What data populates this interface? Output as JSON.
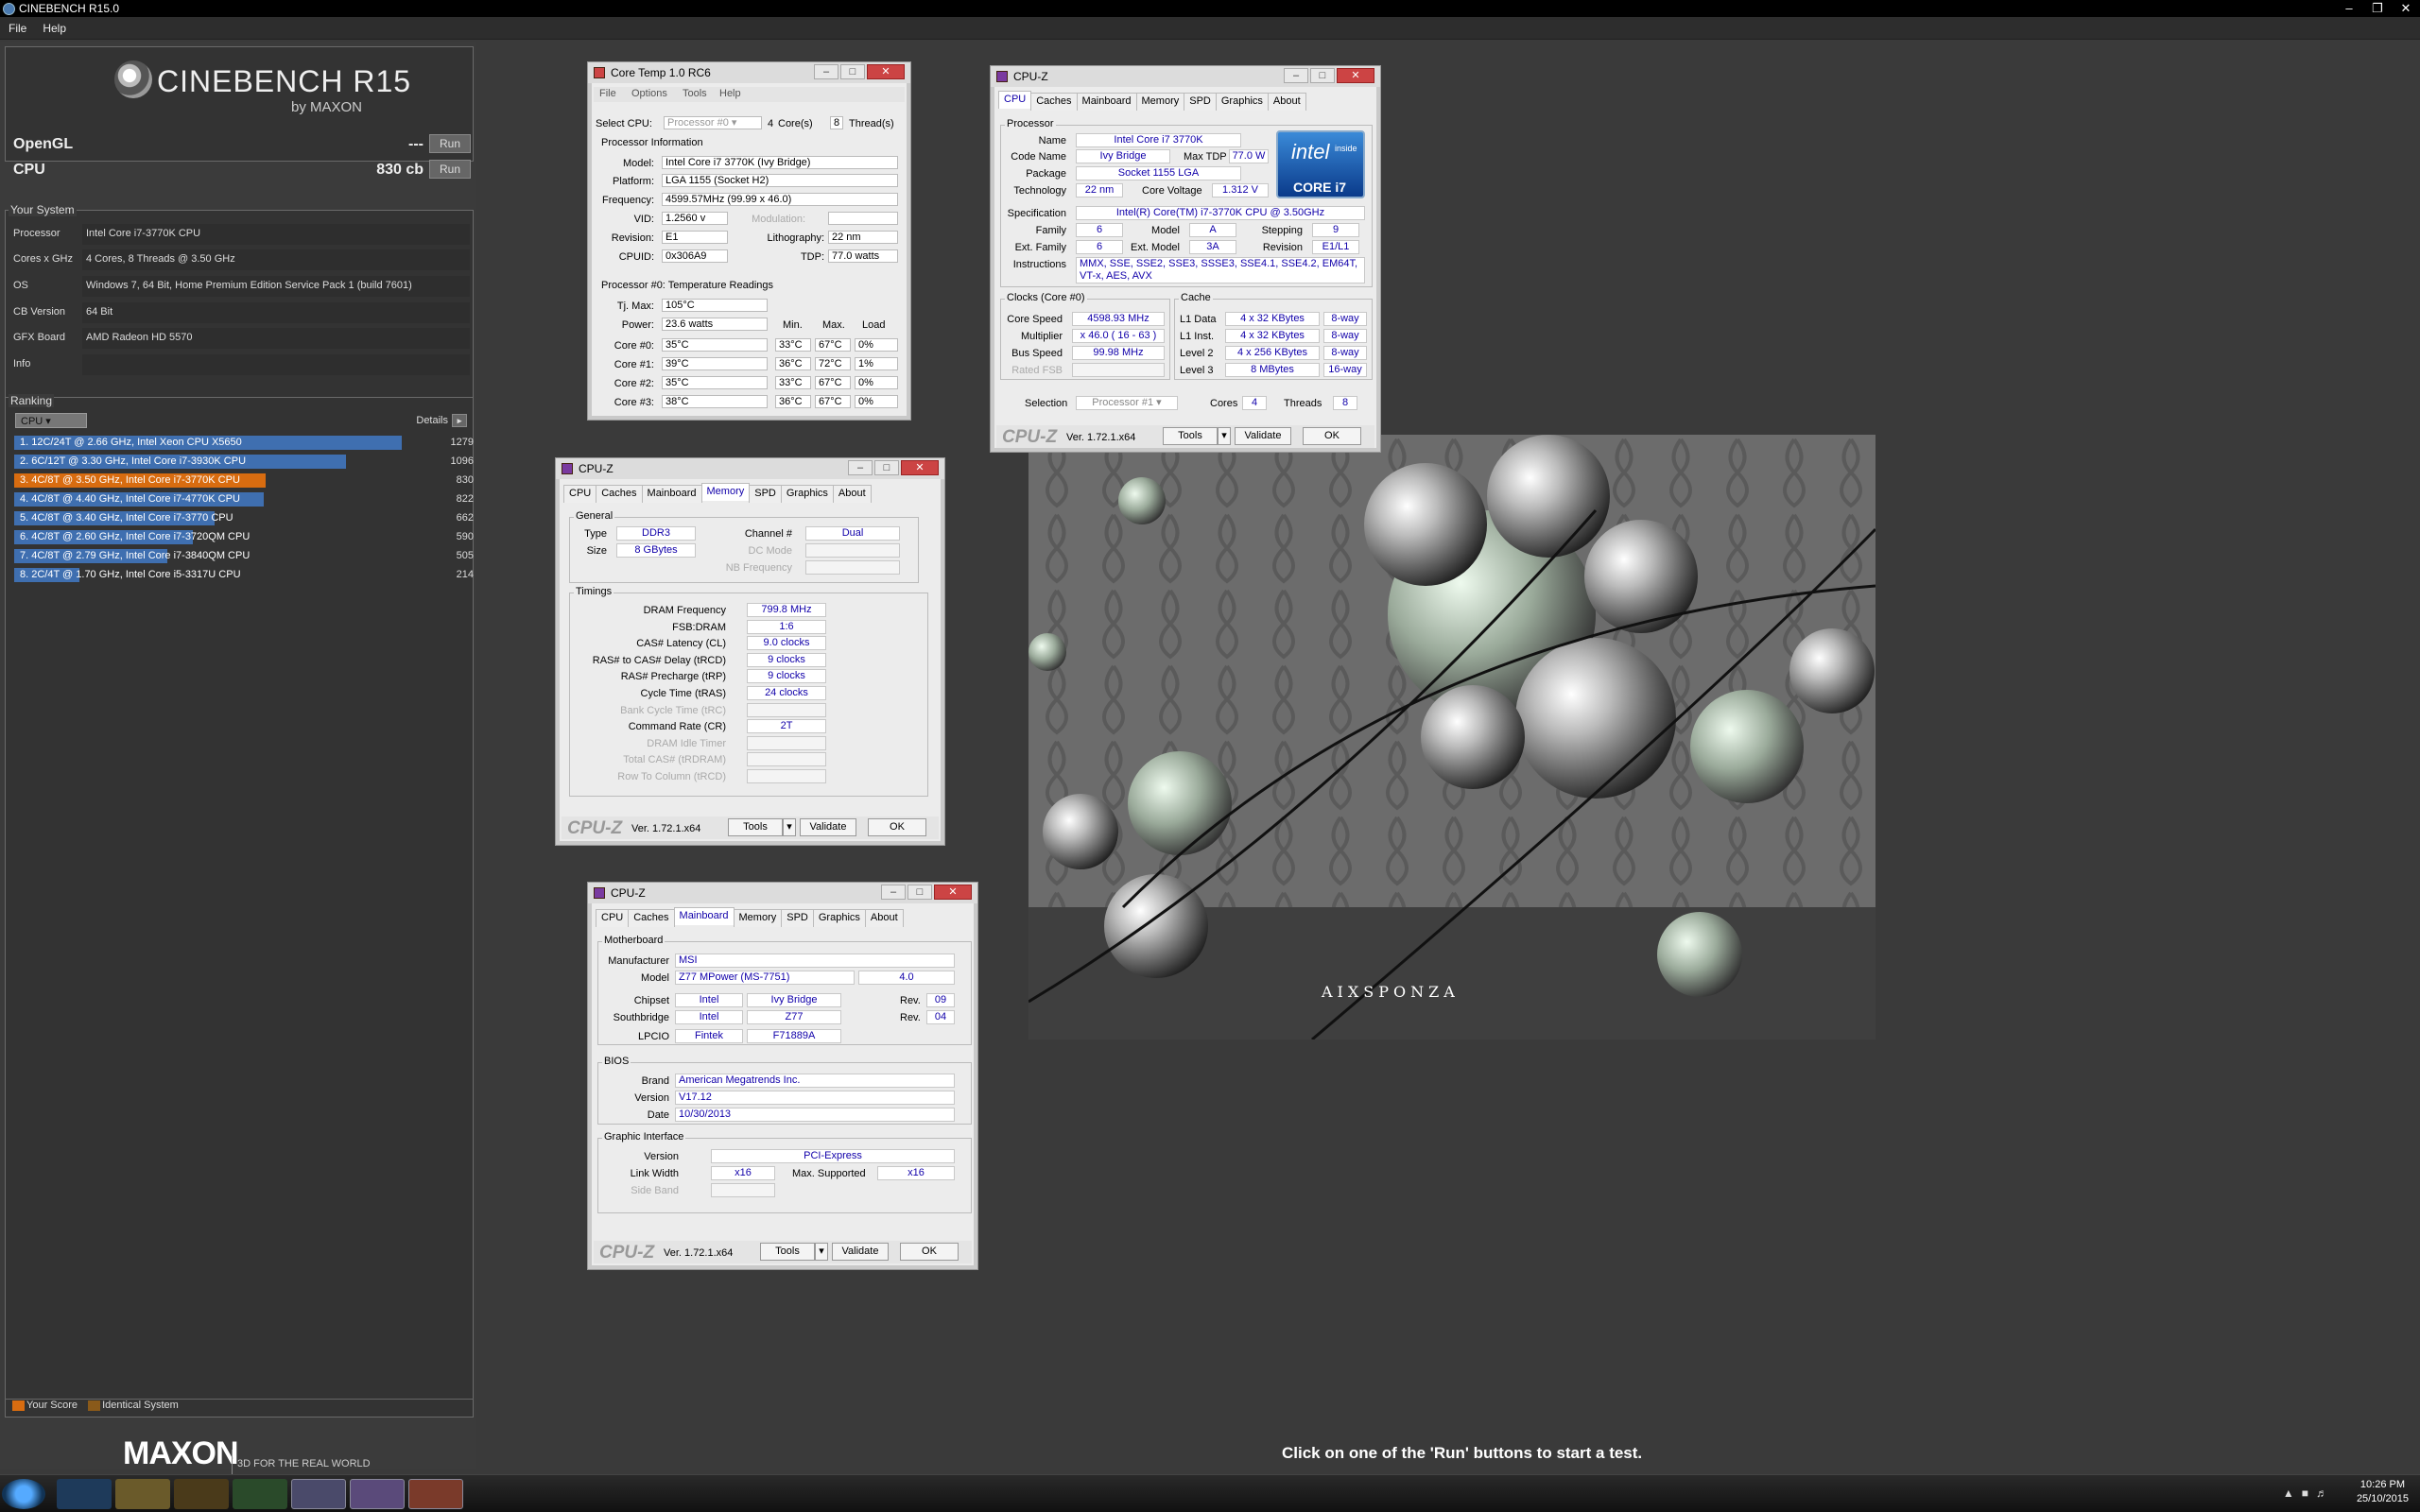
{
  "app": {
    "title": "CINEBENCH R15.0",
    "menu": [
      "File",
      "Help"
    ]
  },
  "brand": {
    "name": "CINEBENCH R15",
    "by": "by MAXON"
  },
  "bench": [
    {
      "name": "OpenGL",
      "value": "---",
      "run": "Run"
    },
    {
      "name": "CPU",
      "value": "830 cb",
      "run": "Run"
    }
  ],
  "system": {
    "title": "Your System",
    "rows": [
      {
        "k": "Processor",
        "v": "Intel Core i7-3770K CPU"
      },
      {
        "k": "Cores x GHz",
        "v": "4 Cores, 8 Threads @ 3.50 GHz"
      },
      {
        "k": "OS",
        "v": "Windows 7, 64 Bit, Home Premium Edition Service Pack 1 (build 7601)"
      },
      {
        "k": "CB Version",
        "v": "64 Bit"
      },
      {
        "k": "GFX Board",
        "v": "AMD Radeon HD 5570"
      },
      {
        "k": "Info",
        "v": ""
      }
    ]
  },
  "ranking": {
    "title": "Ranking",
    "select": "CPU",
    "details": "Details",
    "max": 1279,
    "items": [
      {
        "label": "1. 12C/24T @ 2.66 GHz, Intel Xeon CPU X5650",
        "score": 1279,
        "color": "#3f6fb0"
      },
      {
        "label": "2. 6C/12T @ 3.30 GHz,  Intel Core i7-3930K CPU",
        "score": 1096,
        "color": "#3f6fb0"
      },
      {
        "label": "3. 4C/8T @ 3.50 GHz,  Intel Core i7-3770K CPU",
        "score": 830,
        "color": "#d86c10"
      },
      {
        "label": "4. 4C/8T @ 4.40 GHz, Intel Core i7-4770K CPU",
        "score": 822,
        "color": "#3f6fb0"
      },
      {
        "label": "5. 4C/8T @ 3.40 GHz,  Intel Core i7-3770 CPU",
        "score": 662,
        "color": "#3f6fb0"
      },
      {
        "label": "6. 4C/8T @ 2.60 GHz, Intel Core i7-3720QM CPU",
        "score": 590,
        "color": "#3f6fb0"
      },
      {
        "label": "7. 4C/8T @ 2.79 GHz,  Intel Core i7-3840QM CPU",
        "score": 505,
        "color": "#3f6fb0"
      },
      {
        "label": "8. 2C/4T @ 1.70 GHz,  Intel Core i5-3317U CPU",
        "score": 214,
        "color": "#3f6fb0"
      }
    ]
  },
  "legend": {
    "your": "Your Score",
    "identical": "Identical System"
  },
  "maxon": {
    "logo": "MAXON",
    "tag": "3D FOR THE REAL WORLD"
  },
  "status": "Click on one of the 'Run' buttons to start a test.",
  "coretemp": {
    "title": "Core Temp 1.0 RC6",
    "menu": [
      "File",
      "Options",
      "Tools",
      "Help"
    ],
    "select_cpu": "Select CPU:",
    "processor": "Processor #0",
    "cores": "4",
    "cores_lbl": "Core(s)",
    "threads": "8",
    "threads_lbl": "Thread(s)",
    "info_title": "Processor Information",
    "model_lbl": "Model:",
    "model": "Intel Core i7 3770K (Ivy Bridge)",
    "platform_lbl": "Platform:",
    "platform": "LGA 1155 (Socket H2)",
    "freq_lbl": "Frequency:",
    "freq": "4599.57MHz (99.99 x 46.0)",
    "vid_lbl": "VID:",
    "vid": "1.2560 v",
    "mod_lbl": "Modulation:",
    "rev_lbl": "Revision:",
    "rev": "E1",
    "litho_lbl": "Lithography:",
    "litho": "22 nm",
    "cpuid_lbl": "CPUID:",
    "cpuid": "0x306A9",
    "tdp_lbl": "TDP:",
    "tdp": "77.0 watts",
    "temp_title": "Processor #0: Temperature Readings",
    "tjmax_lbl": "Tj. Max:",
    "tjmax": "105°C",
    "power_lbl": "Power:",
    "power": "23.6 watts",
    "min_lbl": "Min.",
    "max_lbl": "Max.",
    "load_lbl": "Load",
    "cores_rows": [
      {
        "name": "Core #0:",
        "t": "35°C",
        "min": "33°C",
        "max": "67°C",
        "load": "0%"
      },
      {
        "name": "Core #1:",
        "t": "39°C",
        "min": "36°C",
        "max": "72°C",
        "load": "1%"
      },
      {
        "name": "Core #2:",
        "t": "35°C",
        "min": "33°C",
        "max": "67°C",
        "load": "0%"
      },
      {
        "name": "Core #3:",
        "t": "38°C",
        "min": "36°C",
        "max": "67°C",
        "load": "0%"
      }
    ]
  },
  "cpuz": {
    "title": "CPU-Z",
    "tabs": [
      "CPU",
      "Caches",
      "Mainboard",
      "Memory",
      "SPD",
      "Graphics",
      "About"
    ],
    "version": "Ver. 1.72.1.x64",
    "tools": "Tools",
    "validate": "Validate",
    "ok": "OK",
    "logo": "CPU-Z",
    "cpu": {
      "processor_grp": "Processor",
      "name_l": "Name",
      "name": "Intel Core i7 3770K",
      "code_l": "Code Name",
      "code": "Ivy Bridge",
      "tdp_l": "Max TDP",
      "tdp": "77.0 W",
      "pkg_l": "Package",
      "pkg": "Socket 1155 LGA",
      "tech_l": "Technology",
      "tech": "22 nm",
      "volt_l": "Core Voltage",
      "volt": "1.312 V",
      "spec_l": "Specification",
      "spec": "Intel(R) Core(TM) i7-3770K CPU @ 3.50GHz",
      "fam_l": "Family",
      "fam": "6",
      "model_l": "Model",
      "model": "A",
      "step_l": "Stepping",
      "step": "9",
      "efam_l": "Ext. Family",
      "efam": "6",
      "emod_l": "Ext. Model",
      "emod": "3A",
      "rev_l": "Revision",
      "rev": "E1/L1",
      "inst_l": "Instructions",
      "inst": "MMX, SSE, SSE2, SSE3, SSSE3, SSE4.1, SSE4.2, EM64T, VT-x, AES, AVX",
      "clocks_grp": "Clocks (Core #0)",
      "cache_grp": "Cache",
      "cs_l": "Core Speed",
      "cs": "4598.93 MHz",
      "mul_l": "Multiplier",
      "mul": "x 46.0 ( 16 - 63 )",
      "bus_l": "Bus Speed",
      "bus": "99.98 MHz",
      "fsb_l": "Rated FSB",
      "l1d_l": "L1 Data",
      "l1d": "4 x 32 KBytes",
      "l1d_w": "8-way",
      "l1i_l": "L1 Inst.",
      "l1i": "4 x 32 KBytes",
      "l1i_w": "8-way",
      "l2_l": "Level 2",
      "l2": "4 x 256 KBytes",
      "l2_w": "8-way",
      "l3_l": "Level 3",
      "l3": "8 MBytes",
      "l3_w": "16-way",
      "sel_l": "Selection",
      "sel": "Processor #1",
      "cores_l": "Cores",
      "cores": "4",
      "thr_l": "Threads",
      "thr": "8",
      "intel_inside": "intel",
      "inside": "inside",
      "corei7": "CORE i7"
    },
    "mem": {
      "general": "General",
      "type_l": "Type",
      "type": "DDR3",
      "ch_l": "Channel #",
      "ch": "Dual",
      "size_l": "Size",
      "size": "8 GBytes",
      "dc_l": "DC Mode",
      "nb_l": "NB Frequency",
      "timings": "Timings",
      "rows": [
        {
          "k": "DRAM Frequency",
          "v": "799.8 MHz",
          "g": false
        },
        {
          "k": "FSB:DRAM",
          "v": "1:6",
          "g": false
        },
        {
          "k": "CAS# Latency (CL)",
          "v": "9.0 clocks",
          "g": false
        },
        {
          "k": "RAS# to CAS# Delay (tRCD)",
          "v": "9 clocks",
          "g": false
        },
        {
          "k": "RAS# Precharge (tRP)",
          "v": "9 clocks",
          "g": false
        },
        {
          "k": "Cycle Time (tRAS)",
          "v": "24 clocks",
          "g": false
        },
        {
          "k": "Bank Cycle Time (tRC)",
          "v": "",
          "g": true
        },
        {
          "k": "Command Rate (CR)",
          "v": "2T",
          "g": false
        },
        {
          "k": "DRAM Idle Timer",
          "v": "",
          "g": true
        },
        {
          "k": "Total CAS# (tRDRAM)",
          "v": "",
          "g": true
        },
        {
          "k": "Row To Column (tRCD)",
          "v": "",
          "g": true
        }
      ]
    },
    "mb": {
      "mobo": "Motherboard",
      "man_l": "Manufacturer",
      "man": "MSI",
      "model_l": "Model",
      "model": "Z77 MPower (MS-7751)",
      "model_r": "4.0",
      "chip_l": "Chipset",
      "chip": "Intel",
      "chip2": "Ivy Bridge",
      "rev_l": "Rev.",
      "chip_rev": "09",
      "sb_l": "Southbridge",
      "sb": "Intel",
      "sb2": "Z77",
      "sb_rev": "04",
      "lpcio_l": "LPCIO",
      "lpcio": "Fintek",
      "lpcio2": "F71889A",
      "bios": "BIOS",
      "brand_l": "Brand",
      "brand": "American Megatrends Inc.",
      "ver_l": "Version",
      "ver": "V17.12",
      "date_l": "Date",
      "date": "10/30/2013",
      "gi": "Graphic Interface",
      "giv_l": "Version",
      "giv": "PCI-Express",
      "lw_l": "Link Width",
      "lw": "x16",
      "ms_l": "Max. Supported",
      "ms": "x16",
      "sb2_l": "Side Band"
    }
  },
  "render": {
    "watermark": "AIXSPONZA"
  },
  "clock": {
    "time": "10:26 PM",
    "date": "25/10/2015"
  }
}
